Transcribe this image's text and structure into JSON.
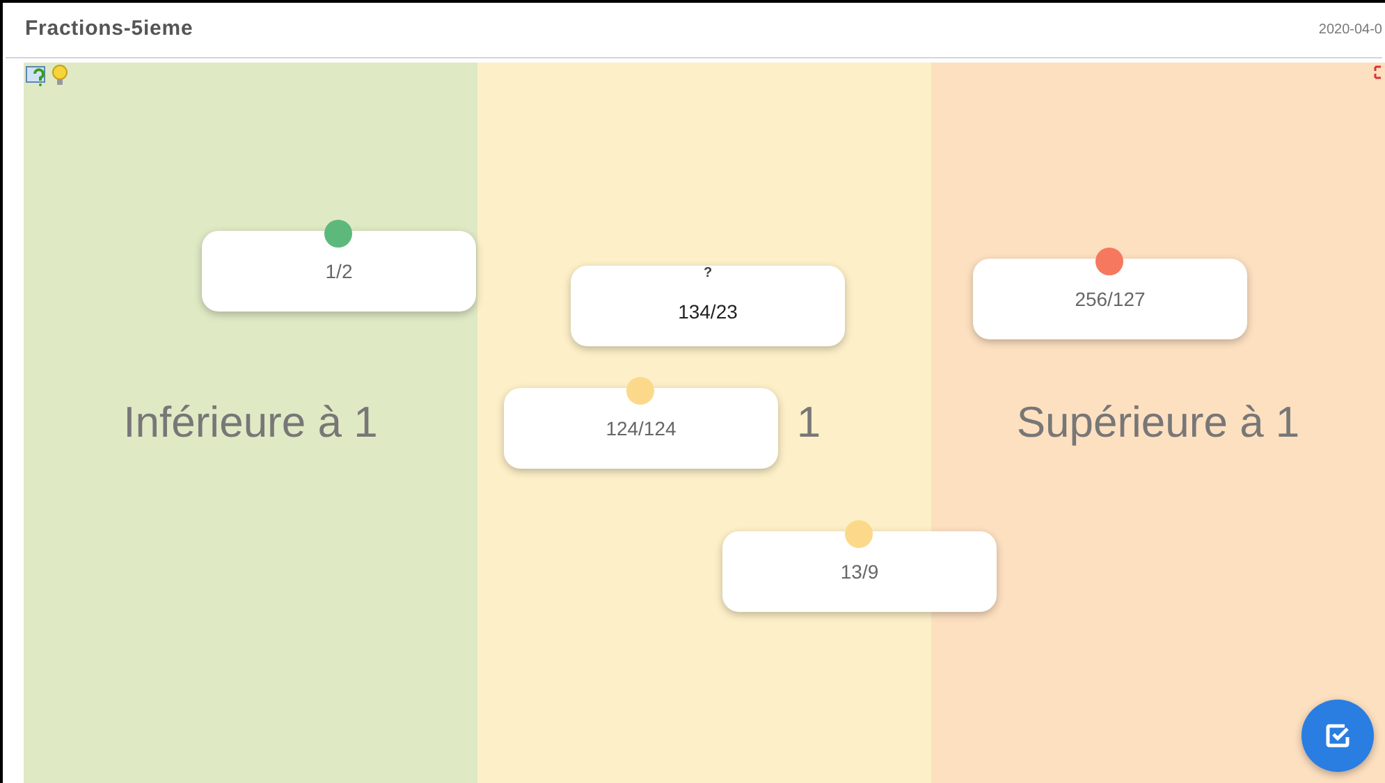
{
  "title": "Fractions-5ieme",
  "date": "2020-04-0",
  "zones": [
    {
      "label": "Inférieure à 1",
      "color": "#dfe9c4"
    },
    {
      "label": "1",
      "color": "#fdf0c8"
    },
    {
      "label": "Supérieure à 1",
      "color": "#fde0c0"
    }
  ],
  "cards": [
    {
      "text": "1/2",
      "kind": "dot",
      "color": "#5cb97b",
      "selected": false
    },
    {
      "text": "134/23",
      "kind": "question",
      "mark": "?",
      "selected": true
    },
    {
      "text": "124/124",
      "kind": "dot",
      "color": "#fcd98a",
      "selected": false
    },
    {
      "text": "256/127",
      "kind": "dot",
      "color": "#f6785f",
      "selected": false
    },
    {
      "text": "13/9",
      "kind": "dot",
      "color": "#fcd98a",
      "selected": false
    }
  ]
}
